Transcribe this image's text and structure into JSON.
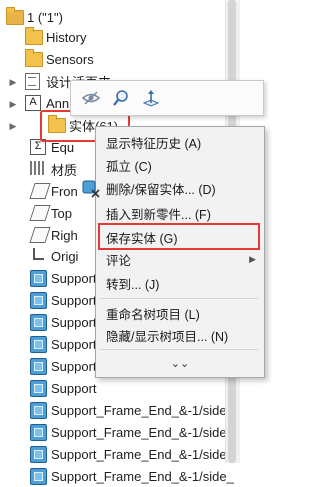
{
  "tree": {
    "rows": [
      {
        "label": "1 (\"1\")",
        "icon": "part-icon"
      },
      {
        "label": "History",
        "icon": "history-icon"
      },
      {
        "label": "Sensors",
        "icon": "sensor-icon"
      },
      {
        "label": "设计活页夹",
        "icon": "binder-icon"
      },
      {
        "label": "Ann",
        "icon": "annotation-icon"
      },
      {
        "label": "实体(61)",
        "icon": "solid-bodies-folder-icon"
      },
      {
        "label": "Equ",
        "icon": "equations-icon"
      },
      {
        "label": "材质",
        "icon": "material-icon"
      },
      {
        "label": "Fron",
        "icon": "plane-icon"
      },
      {
        "label": "Top",
        "icon": "plane-icon"
      },
      {
        "label": "Righ",
        "icon": "plane-icon"
      },
      {
        "label": "Origi",
        "icon": "origin-icon"
      },
      {
        "label": "Support",
        "icon": "body-icon"
      },
      {
        "label": "Support",
        "icon": "body-icon"
      },
      {
        "label": "Support",
        "icon": "body-icon"
      },
      {
        "label": "Support",
        "icon": "body-icon"
      },
      {
        "label": "Support",
        "icon": "body-icon"
      },
      {
        "label": "Support",
        "icon": "body-icon"
      },
      {
        "label": "Support_Frame_End_&-1/side_",
        "icon": "body-icon"
      },
      {
        "label": "Support_Frame_End_&-1/side_",
        "icon": "body-icon"
      },
      {
        "label": "Support_Frame_End_&-1/side_",
        "icon": "body-icon"
      },
      {
        "label": "Support_Frame_End_&-1/side_",
        "icon": "body-icon"
      }
    ]
  },
  "toolbar": {
    "buttons": [
      "hide-icon",
      "zoom-to-selection-icon",
      "normal-to-icon"
    ]
  },
  "context_menu": {
    "items": [
      {
        "label": "显示特征历史 (A)",
        "submenu": false
      },
      {
        "label": "孤立 (C)",
        "submenu": false
      },
      {
        "label": "删除/保留实体... (D)",
        "submenu": false
      },
      {
        "label": "插入到新零件... (F)",
        "submenu": false
      },
      {
        "label": "保存实体 (G)",
        "submenu": false
      },
      {
        "label": "评论",
        "submenu": true
      },
      {
        "label": "转到... (J)",
        "submenu": false
      },
      {
        "label": "重命名树项目 (L)",
        "submenu": false
      },
      {
        "label": "隐藏/显示树项目... (N)",
        "submenu": false
      }
    ],
    "more": "⌄⌄"
  },
  "colors": {
    "highlight": "#e53935",
    "folder": "#f3c24d",
    "body": "#4f9fd6"
  }
}
